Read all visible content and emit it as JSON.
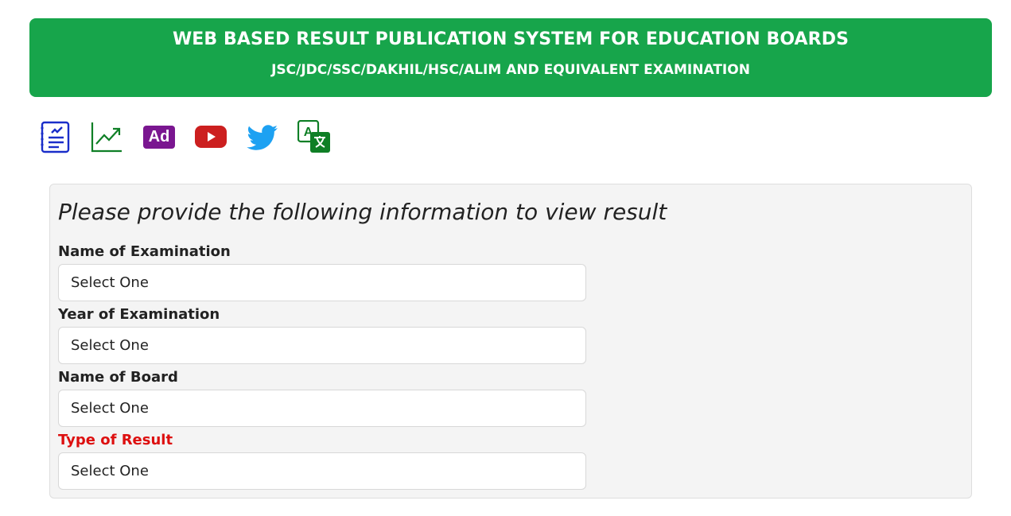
{
  "header": {
    "title": "WEB BASED RESULT PUBLICATION SYSTEM FOR EDUCATION BOARDS",
    "subtitle": "JSC/JDC/SSC/DAKHIL/HSC/ALIM AND EQUIVALENT EXAMINATION"
  },
  "icons": [
    {
      "name": "result-list-icon",
      "color": "#1a2ec9"
    },
    {
      "name": "stats-chart-icon",
      "color": "#0f7f26"
    },
    {
      "name": "ad-icon",
      "label": "Ad",
      "color": "#7a1690"
    },
    {
      "name": "youtube-icon",
      "color": "#cc1f1f"
    },
    {
      "name": "twitter-icon",
      "color": "#1da1f2"
    },
    {
      "name": "translate-icon",
      "label": "A",
      "color": "#0f7f26"
    }
  ],
  "form": {
    "prompt": "Please provide the following information to view result",
    "fields": [
      {
        "label": "Name of Examination",
        "value": "Select One"
      },
      {
        "label": "Year of Examination",
        "value": "Select One"
      },
      {
        "label": "Name of Board",
        "value": "Select One"
      },
      {
        "label": "Type of Result",
        "value": "Select One",
        "highlight_color": "#dd0f0f"
      }
    ]
  },
  "colors": {
    "header_bg": "#17a54b",
    "panel_bg": "#f4f4f4"
  }
}
